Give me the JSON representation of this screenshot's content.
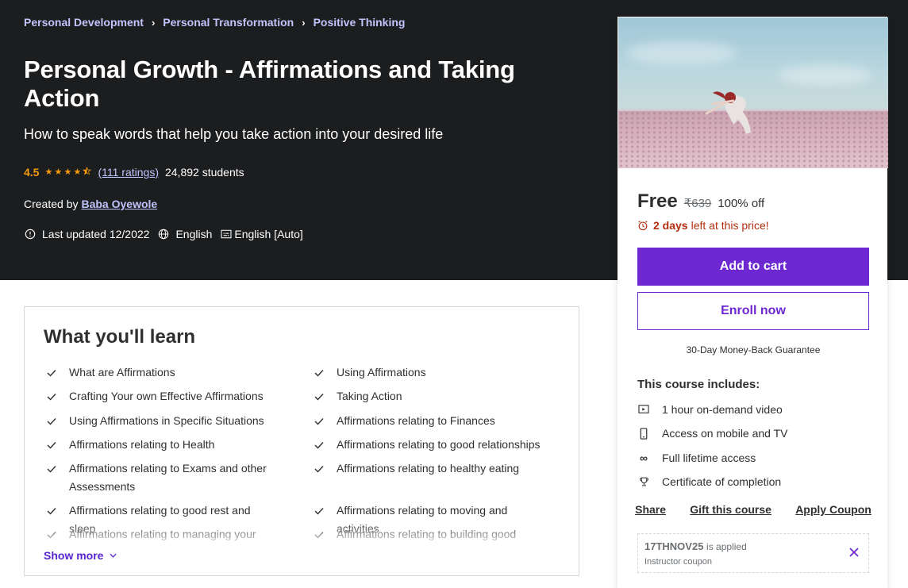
{
  "breadcrumb": [
    {
      "label": "Personal Development"
    },
    {
      "label": "Personal Transformation"
    },
    {
      "label": "Positive Thinking"
    }
  ],
  "course": {
    "title": "Personal Growth - Affirmations and Taking Action",
    "subtitle": "How to speak words that help you take action into your desired life",
    "rating_value": "4.5",
    "rating_stars": 4.5,
    "ratings_count": "(111 ratings)",
    "students": "24,892 students",
    "created_by_label": "Created by",
    "author": "Baba Oyewole",
    "last_updated": "Last updated 12/2022",
    "language": "English",
    "captions": "English [Auto]"
  },
  "learn": {
    "title": "What you'll learn",
    "items_left": [
      "What are Affirmations",
      "Crafting Your own Effective Affirmations",
      "Using Affirmations in Specific Situations",
      "Affirmations relating to Health",
      "Affirmations relating to Exams and other Assessments",
      "Affirmations relating to good rest and sleep",
      "Affirmations relating to managing your"
    ],
    "items_right": [
      "Using Affirmations",
      "Taking Action",
      "Affirmations relating to Finances",
      "Affirmations relating to good relationships",
      "Affirmations relating to healthy eating",
      "Affirmations relating to moving and activities",
      "Affirmations relating to building good"
    ],
    "show_more": "Show more"
  },
  "sidebar": {
    "price_now": "Free",
    "price_old": "₹639",
    "discount": "100% off",
    "timer_bold": "2 days",
    "timer_rest": "left at this price!",
    "add_to_cart": "Add to cart",
    "enroll_now": "Enroll now",
    "guarantee": "30-Day Money-Back Guarantee",
    "includes_title": "This course includes:",
    "includes": [
      {
        "icon": "video-icon",
        "label": "1 hour on-demand video"
      },
      {
        "icon": "mobile-icon",
        "label": "Access on mobile and TV"
      },
      {
        "icon": "infinity-icon",
        "label": "Full lifetime access"
      },
      {
        "icon": "trophy-icon",
        "label": "Certificate of completion"
      }
    ],
    "actions": {
      "share": "Share",
      "gift": "Gift this course",
      "coupon": "Apply Coupon"
    },
    "coupon_code": "17THNOV25",
    "coupon_applied": "is applied",
    "coupon_note": "Instructor coupon"
  },
  "colors": {
    "hero_bg": "#1c1d1f",
    "link_purple_light": "#c0c4fc",
    "star": "#f69c08",
    "primary": "#6d28d2",
    "timer_red": "#b32d0f"
  }
}
